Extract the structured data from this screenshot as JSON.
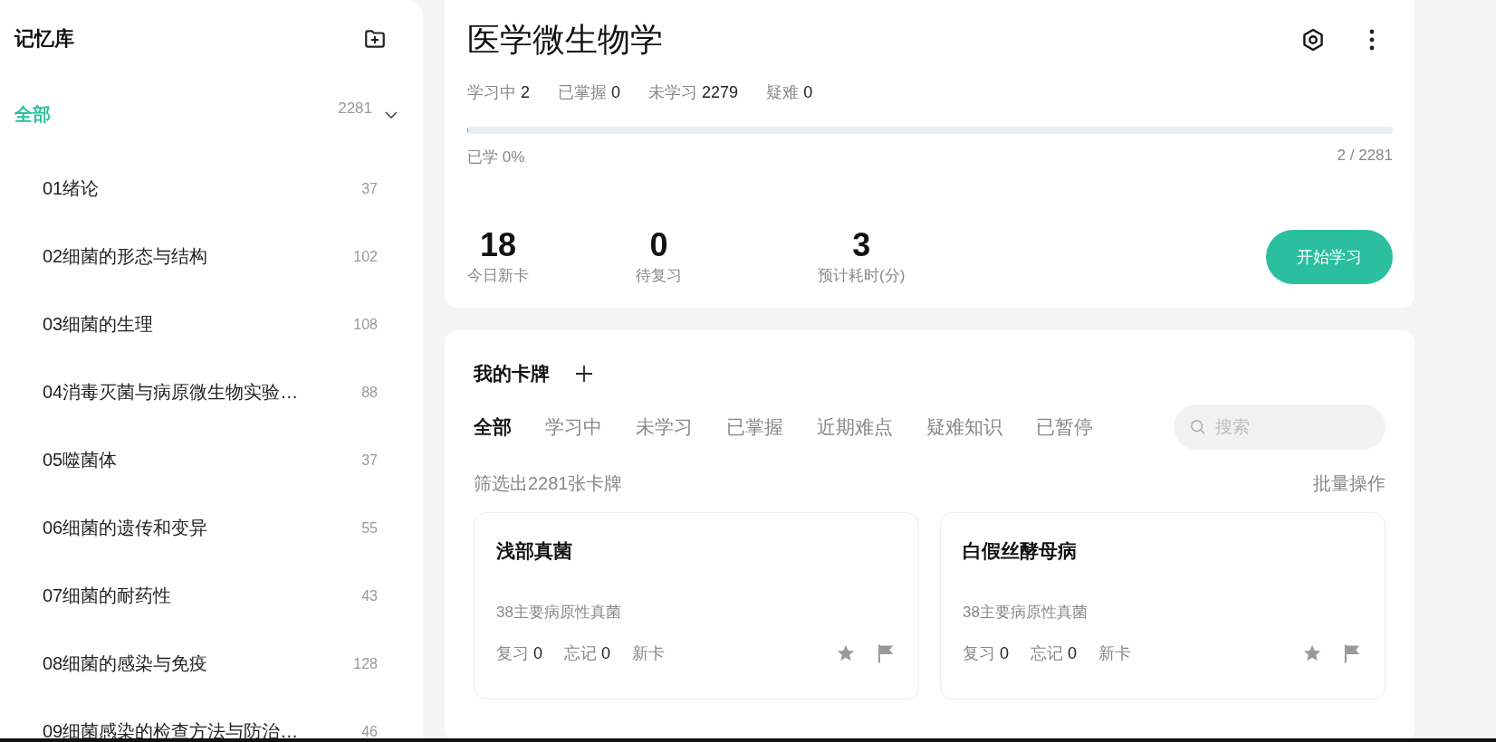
{
  "sidebar": {
    "title": "记忆库",
    "root": {
      "label": "全部",
      "count": "2281",
      "selected": true,
      "expanded": true,
      "children": [
        {
          "label": "01绪论",
          "count": "37",
          "selected": false
        },
        {
          "label": "02细菌的形态与结构",
          "count": "102",
          "selected": false
        },
        {
          "label": "03细菌的生理",
          "count": "108",
          "selected": false
        },
        {
          "label": "04消毒灭菌与病原微生物实验…",
          "count": "88",
          "selected": false
        },
        {
          "label": "05噬菌体",
          "count": "37",
          "selected": false
        },
        {
          "label": "06细菌的遗传和变异",
          "count": "55",
          "selected": false
        },
        {
          "label": "07细菌的耐药性",
          "count": "43",
          "selected": false
        },
        {
          "label": "08细菌的感染与免疫",
          "count": "128",
          "selected": false
        },
        {
          "label": "09细菌感染的检查方法与防治…",
          "count": "46",
          "selected": false
        }
      ]
    }
  },
  "deck": {
    "title": "医学微生物学",
    "stats": [
      {
        "label": "学习中",
        "value": "2"
      },
      {
        "label": "已掌握",
        "value": "0"
      },
      {
        "label": "未学习",
        "value": "2279"
      },
      {
        "label": "疑难",
        "value": "0"
      }
    ],
    "progress": {
      "level": 0.001,
      "label": "已学 0%",
      "count": "2 / 2281"
    },
    "today": [
      {
        "value": "18",
        "label": "今日新卡"
      },
      {
        "value": "0",
        "label": "待复习"
      },
      {
        "value": "3",
        "label": "预计耗时(分)"
      }
    ],
    "start_button": "开始学习"
  },
  "cards_panel": {
    "title": "我的卡牌",
    "tabs": [
      {
        "label": "全部",
        "selected": true
      },
      {
        "label": "学习中",
        "selected": false
      },
      {
        "label": "未学习",
        "selected": false
      },
      {
        "label": "已掌握",
        "selected": false
      },
      {
        "label": "近期难点",
        "selected": false
      },
      {
        "label": "疑难知识",
        "selected": false
      },
      {
        "label": "已暂停",
        "selected": false
      }
    ],
    "search": {
      "placeholder": "搜索"
    },
    "filter_text": "筛选出2281张卡牌",
    "bulk_action": "批量操作",
    "cards": [
      {
        "title": "浅部真菌",
        "chapter": "38主要病原性真菌",
        "stats": [
          {
            "label": "复习",
            "value": "0"
          },
          {
            "label": "忘记",
            "value": "0"
          },
          {
            "label": "新卡"
          }
        ]
      },
      {
        "title": "白假丝酵母病",
        "chapter": "38主要病原性真菌",
        "stats": [
          {
            "label": "复习",
            "value": "0"
          },
          {
            "label": "忘记",
            "value": "0"
          },
          {
            "label": "新卡"
          }
        ]
      }
    ]
  }
}
